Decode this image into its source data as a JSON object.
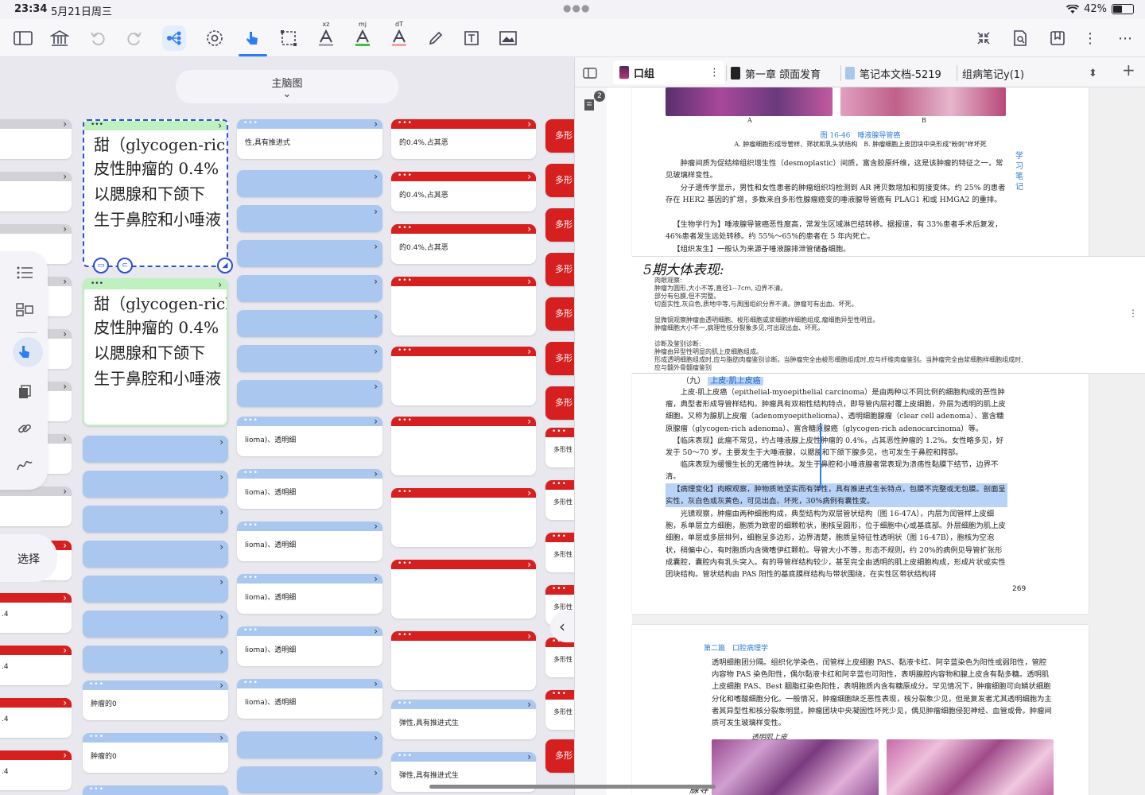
{
  "status": {
    "time": "23:34",
    "date": "5月21日周三",
    "battery": "42%"
  },
  "toolbar": {
    "sup_xz": "xz",
    "sup_mj": "mj",
    "sup_dt": "dT"
  },
  "mindmap": {
    "title": "主脑图",
    "col_b_big_lines": [
      "甜（glycogen-rich  ac",
      "皮性肿瘤的 0.4%",
      "以腮腺和下颌下",
      "生于鼻腔和小唾液"
    ],
    "col_b_small": [
      "肿瘤的0",
      "肿瘤的0"
    ],
    "col_c_top": "性,具有推进式",
    "col_c_items": [
      "lioma)、透明细",
      "lioma)、透明细",
      "lioma)、透明细",
      "lioma)、透明细",
      "lioma)、透明细",
      "lioma)、透明细"
    ],
    "col_d_items": [
      "的0.4%,占其恶",
      "的0.4%,占其恶",
      "的0.4%,占其恶"
    ],
    "col_d_bottom": [
      "弹性,具有推进式生",
      "弹性,具有推进式生"
    ],
    "col_e_big": "多形",
    "col_e_small": "多形性",
    "col_a_red": ".4",
    "select_label": "选择"
  },
  "reader": {
    "tabs": [
      "口组",
      "第一章 颌面发育",
      "笔记本文档-5219",
      "组病笔记y(1)"
    ],
    "badge": "2",
    "page1": {
      "fig_labels": [
        "A",
        "B"
      ],
      "fig_title": "图 16-46　唾液腺导管癌",
      "fig_caption": "A. 肿瘤细胞形成导管样、筛状和乳头状结构　B. 肿瘤细胞上皮团块中央形成\"粉刺\"样坏死",
      "para1": "肿瘤间质为促结缔组织增生性（desmoplastic）间质，富含胶原纤维，这是该肿瘤的特征之一，常见玻璃样变性。",
      "para2": "分子遗传学显示，男性和女性患者的肿瘤组织均检测到 AR 拷贝数增加和剪接变体。约 25% 的患者存在 HER2 基因的扩增，多数来自多形性腺瘤癌变的唾液腺导管癌有 PLAG1 和或 HMGA2 的重排。",
      "para3": "【生物学行为】唾液腺导管癌恶性度高，常发生区域淋巴结转移。据报道，有 33%患者手术后复发，46%患者发生远处转移。约 55%～65%的患者在 5 年内死亡。",
      "para4": "【组织发生】一般认为来源于唾液腺排泄管储备细胞。",
      "side_note": "学习笔记"
    },
    "note": {
      "handwriting": "5期大体表现:",
      "lines": [
        "肉眼观察:",
        "肿瘤为圆形,大小不等,直径1--7cm, 边界不清。",
        "部分有包膜,但不完整。",
        "切面实性,灰白色,质地中等,与周围组织分界不清。肿瘤可有出血、坏死。",
        "",
        "显微镜观察肿瘤由透明细胞、梭形细胞或浆细胞样细胞组成,瘤细胞异型性明显。",
        "肿瘤细胞大小不一,病理性核分裂象多见,可出现出血、坏死。",
        "",
        "诊断及鉴别诊断:",
        "肿瘤由异型性明显的肌上皮细胞组成。",
        "形成透明细胞组成时,应与脂肪肉瘤鉴别诊断。当肿瘤完全由梭形细胞组成时,应与纤维肉瘤鉴别。当肿瘤完全由浆细胞样细胞组成时,",
        "应与髓外骨髓瘤鉴别"
      ]
    },
    "page2": {
      "heading_num": "（九）",
      "heading": "上皮-肌上皮癌",
      "paras": [
        "上皮-肌上皮癌（epithelial-myoepithelial carcinoma）是由两种以不同比例的细胞构成的恶性肿瘤，典型者形成导管样结构。肿瘤具有双相性结构特点，即导管内层衬覆上皮细胞，外层为透明的肌上皮细胞。又称为腺肌上皮瘤（adenomyoepithelioma）、透明细胞腺瘤（clear cell adenoma）、富含糖原腺瘤（glycogen-rich adenoma）、富含糖原腺癌（glycogen-rich adenocarcinoma）等。",
        "【临床表现】此瘤不常见，约占唾液腺上皮性肿瘤的 0.4%，占其恶性肿瘤的 1.2%。女性略多见，好发于 50～70 岁。主要发生于大唾液腺，以腮腺和下颌下腺多见，也可发生于鼻腔和腭部。",
        "临床表现为缓慢生长的无痛性肿块。发生于鼻腔和小唾液腺者常表现为溃疡性黏膜下结节，边界不清。",
        "【病理变化】肉眼观察，肿物质地坚实而有弹性，具有推进式生长特点，包膜不完整或无包膜。剖面呈实性，灰白色或灰黄色，可见出血、坏死，30%病例有囊性变。",
        "光镜观察，肿瘤由两种细胞构成，典型结构为双层管状结构（图 16-47A），内层为闰管样上皮细胞，系单层立方细胞，胞质为致密的细颗粒状，胞核呈圆形，位于细胞中心或基底部。外层细胞为肌上皮细胞，单层或多层排列，细胞呈多边形，边界清楚，胞质呈特征性透明状（图 16-47B），胞核为空泡状，稍偏中心，有时胞质内含微嗜伊红颗粒。导管大小不等，形态不规则，约 20%的病例见导管扩张形成囊腔，囊腔内有乳头突入。有的导管样结构较少，甚至完全由透明的肌上皮细胞构成，形成片状或实性团块结构。管状结构由 PAS 阳性的基底膜样结构与带状围绕，在实性区带状结构将"
      ],
      "page_no": "269"
    },
    "page3": {
      "header": "第二篇　口腔病理学",
      "para": "透明细胞团分隔。组织化学染色，闰管样上皮细胞 PAS、黏液卡红、阿辛蓝染色为阳性或弱阳性，管腔内容物 PAS 染色阳性，偶尔黏液卡红和阿辛蓝也可阳性，表明腺腔内容物和腺上皮含有黏多糖。透明肌上皮细胞 PAS、Best 胭脂红染色阳性，表明胞质内含有糖原成分。罕见情况下，肿瘤细胞可向鳞状细胞分化和嗜酸细胞分化。一般情况，肿瘤细胞缺乏恶性表现，核分裂象少见，但是复发者尤其透明细胞为主者其异型性和核分裂象明显。肿瘤团块中央凝固性坏死少见，偶见肿瘤细胞侵犯神经、血管或骨。肿瘤间质可发生玻璃样变性。",
      "annotation": "透明肌上皮",
      "annotation2": "腺导"
    }
  },
  "colors": {
    "accent": "#2d7df6",
    "red": "#d62020",
    "blue_card": "#a9c7ef",
    "green_card": "#bff0c0"
  }
}
